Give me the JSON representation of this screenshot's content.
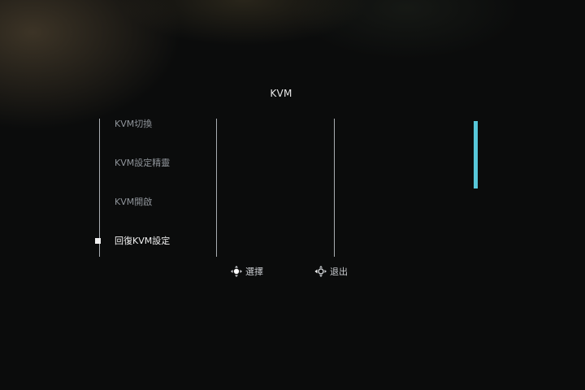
{
  "osd": {
    "title": "KVM",
    "menu_items": [
      {
        "label": "KVM切換",
        "selected": false
      },
      {
        "label": "KVM設定精靈",
        "selected": false
      },
      {
        "label": "KVM開啟",
        "selected": false
      },
      {
        "label": "回復KVM設定",
        "selected": true
      }
    ],
    "scroll_position": 0.0
  },
  "footer": {
    "select_icon": "joystick-press-icon",
    "select_label": "選擇",
    "exit_icon": "joystick-left-icon",
    "exit_label": "退出"
  },
  "colors": {
    "background": "#0b0c0c",
    "accent": "#57c7d9",
    "text_active": "#f2f2f2",
    "text_inactive": "#8f949a"
  }
}
